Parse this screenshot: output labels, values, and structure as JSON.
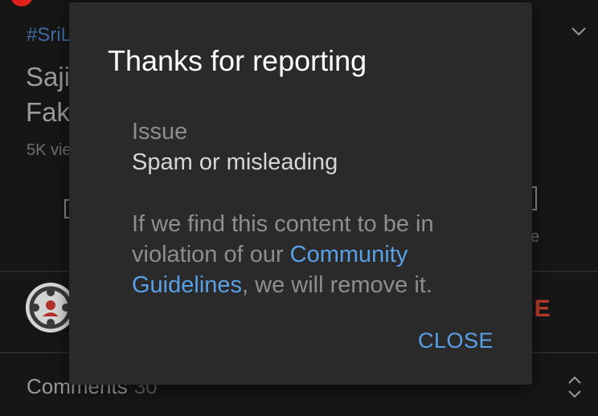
{
  "background": {
    "hashtag": "#SriL",
    "title_line1": "Sajit",
    "title_line2": "Fake",
    "views": "5K vie",
    "action_label_right": "e",
    "subscribe_label": "RIBE",
    "comments_label": "Comments",
    "comments_count": "30"
  },
  "dialog": {
    "title": "Thanks for reporting",
    "issue_label": "Issue",
    "issue_value": "Spam or misleading",
    "message_line1": "If we find this content to be in",
    "message_line2_prefix": "violation of our ",
    "link_part1": "Community",
    "link_part2": "Guidelines",
    "message_suffix": ", we will remove it.",
    "close_label": "CLOSE"
  },
  "colors": {
    "link": "#5aa0e6",
    "dialog_bg": "#2a2a2a",
    "subscribe": "#b93a2c"
  },
  "icons": [
    "chevron-down-icon",
    "expand-collapse-icon",
    "channel-avatar"
  ]
}
